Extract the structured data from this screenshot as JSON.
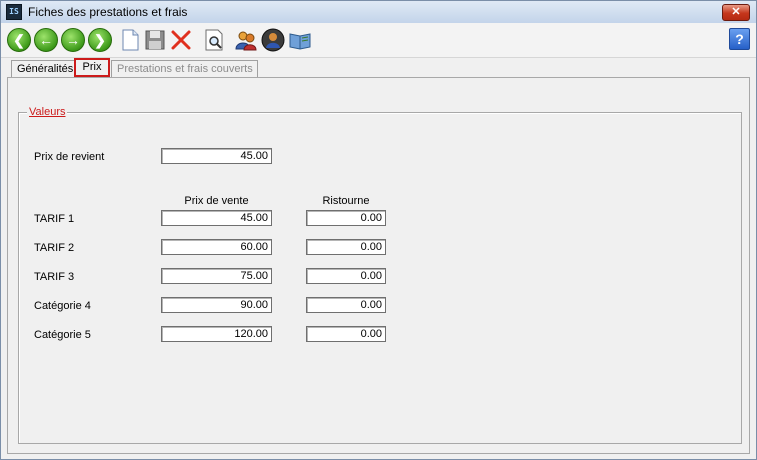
{
  "window": {
    "title": "Fiches des prestations et frais",
    "app_icon_text": "IS",
    "close_glyph": "✕"
  },
  "toolbar": {
    "buttons": [
      {
        "name": "first-record-button",
        "icon": "arrow-left-end-icon",
        "glyph": "❮"
      },
      {
        "name": "previous-record-button",
        "icon": "arrow-left-icon",
        "glyph": "←"
      },
      {
        "name": "next-record-button",
        "icon": "arrow-right-icon",
        "glyph": "→"
      },
      {
        "name": "last-record-button",
        "icon": "arrow-right-end-icon",
        "glyph": "❯"
      }
    ],
    "help_glyph": "?"
  },
  "tabs": [
    {
      "label": "Généralités"
    },
    {
      "label": "Prix"
    },
    {
      "label": "Prestations et frais couverts"
    }
  ],
  "group": {
    "title": "Valeurs"
  },
  "cost": {
    "label": "Prix de revient",
    "value": "45.00"
  },
  "columns": {
    "sale": "Prix de vente",
    "rebate": "Ristourne"
  },
  "rows": [
    {
      "label": "TARIF 1",
      "sale": "45.00",
      "rebate": "0.00"
    },
    {
      "label": "TARIF 2",
      "sale": "60.00",
      "rebate": "0.00"
    },
    {
      "label": "TARIF 3",
      "sale": "75.00",
      "rebate": "0.00"
    },
    {
      "label": "Catégorie 4",
      "sale": "90.00",
      "rebate": "0.00"
    },
    {
      "label": "Catégorie 5",
      "sale": "120.00",
      "rebate": "0.00"
    }
  ]
}
